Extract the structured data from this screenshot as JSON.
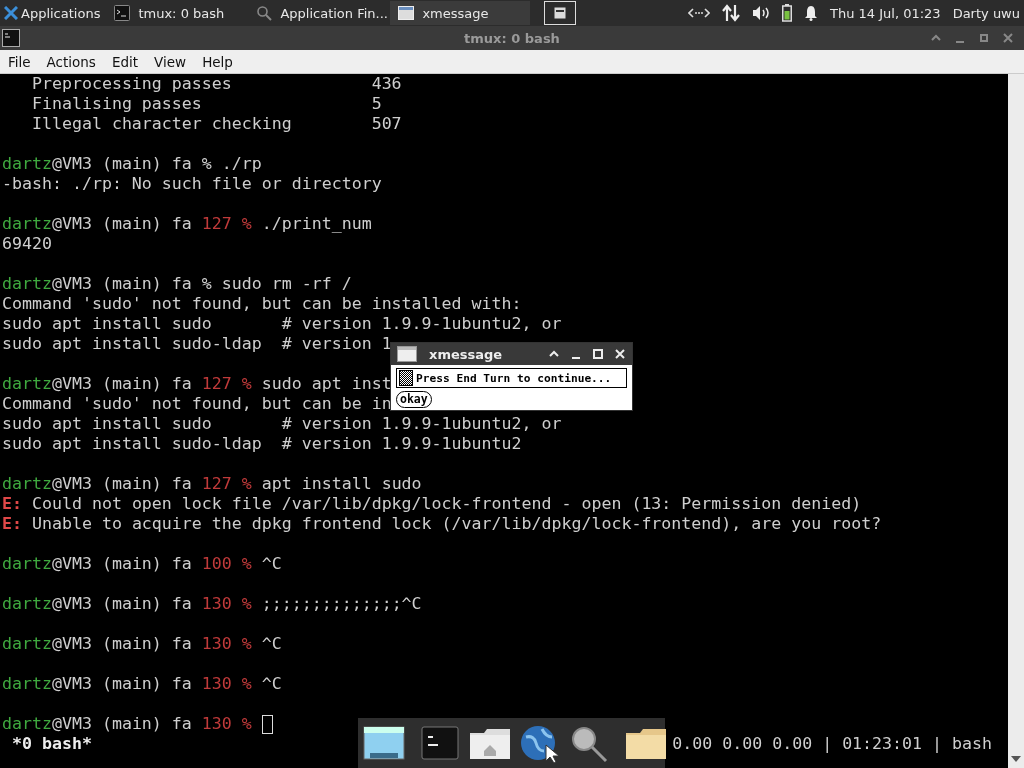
{
  "top_panel": {
    "applications_label": "Applications",
    "tasks": [
      {
        "label": "tmux: 0 bash",
        "selected": false
      },
      {
        "label": "Application Fin...",
        "selected": false
      },
      {
        "label": "xmessage",
        "selected": true
      }
    ],
    "clock": "Thu 14 Jul, 01:23",
    "user": "Darty uwu"
  },
  "window": {
    "title": "tmux: 0 bash"
  },
  "menu": [
    "File",
    "Actions",
    "Edit",
    "View",
    "Help"
  ],
  "terminal": {
    "lines": [
      {
        "kind": "text",
        "segments": [
          {
            "kind": "plain",
            "text": "   Preprocessing passes              436"
          }
        ]
      },
      {
        "kind": "text",
        "segments": [
          {
            "kind": "plain",
            "text": "   Finalising passes                 5"
          }
        ]
      },
      {
        "kind": "text",
        "segments": [
          {
            "kind": "plain",
            "text": "   Illegal character checking        507"
          }
        ]
      },
      {
        "kind": "blank"
      },
      {
        "kind": "text",
        "segments": [
          {
            "kind": "user",
            "text": "dartz"
          },
          {
            "kind": "plain",
            "text": "@VM3 (main) fa % ./rp"
          }
        ]
      },
      {
        "kind": "text",
        "segments": [
          {
            "kind": "plain",
            "text": "-bash: ./rp: No such file or directory"
          }
        ]
      },
      {
        "kind": "blank"
      },
      {
        "kind": "text",
        "segments": [
          {
            "kind": "user",
            "text": "dartz"
          },
          {
            "kind": "plain",
            "text": "@VM3 (main) fa "
          },
          {
            "kind": "code",
            "text": "127 %"
          },
          {
            "kind": "plain",
            "text": " ./print_num"
          }
        ]
      },
      {
        "kind": "text",
        "segments": [
          {
            "kind": "plain",
            "text": "69420"
          }
        ]
      },
      {
        "kind": "blank"
      },
      {
        "kind": "text",
        "segments": [
          {
            "kind": "user",
            "text": "dartz"
          },
          {
            "kind": "plain",
            "text": "@VM3 (main) fa % sudo rm -rf /"
          }
        ]
      },
      {
        "kind": "text",
        "segments": [
          {
            "kind": "plain",
            "text": "Command 'sudo' not found, but can be installed with:"
          }
        ]
      },
      {
        "kind": "text",
        "segments": [
          {
            "kind": "plain",
            "text": "sudo apt install sudo       # version 1.9.9-1ubuntu2, or"
          }
        ]
      },
      {
        "kind": "text",
        "segments": [
          {
            "kind": "plain",
            "text": "sudo apt install sudo-ldap  # version 1"
          }
        ]
      },
      {
        "kind": "blank"
      },
      {
        "kind": "text",
        "segments": [
          {
            "kind": "user",
            "text": "dartz"
          },
          {
            "kind": "plain",
            "text": "@VM3 (main) fa "
          },
          {
            "kind": "code",
            "text": "127 %"
          },
          {
            "kind": "plain",
            "text": " sudo apt inst"
          }
        ]
      },
      {
        "kind": "text",
        "segments": [
          {
            "kind": "plain",
            "text": "Command 'sudo' not found, but can be in"
          }
        ]
      },
      {
        "kind": "text",
        "segments": [
          {
            "kind": "plain",
            "text": "sudo apt install sudo       # version 1.9.9-1ubuntu2, or"
          }
        ]
      },
      {
        "kind": "text",
        "segments": [
          {
            "kind": "plain",
            "text": "sudo apt install sudo-ldap  # version 1.9.9-1ubuntu2"
          }
        ]
      },
      {
        "kind": "blank"
      },
      {
        "kind": "text",
        "segments": [
          {
            "kind": "user",
            "text": "dartz"
          },
          {
            "kind": "plain",
            "text": "@VM3 (main) fa "
          },
          {
            "kind": "code",
            "text": "127 %"
          },
          {
            "kind": "plain",
            "text": " apt install sudo"
          }
        ]
      },
      {
        "kind": "text",
        "segments": [
          {
            "kind": "error",
            "text": "E:"
          },
          {
            "kind": "plain",
            "text": " Could not open lock file /var/lib/dpkg/lock-frontend - open (13: Permission denied)"
          }
        ]
      },
      {
        "kind": "text",
        "segments": [
          {
            "kind": "error",
            "text": "E:"
          },
          {
            "kind": "plain",
            "text": " Unable to acquire the dpkg frontend lock (/var/lib/dpkg/lock-frontend), are you root?"
          }
        ]
      },
      {
        "kind": "blank"
      },
      {
        "kind": "text",
        "segments": [
          {
            "kind": "user",
            "text": "dartz"
          },
          {
            "kind": "plain",
            "text": "@VM3 (main) fa "
          },
          {
            "kind": "code",
            "text": "100 %"
          },
          {
            "kind": "plain",
            "text": " ^C"
          }
        ]
      },
      {
        "kind": "blank"
      },
      {
        "kind": "text",
        "segments": [
          {
            "kind": "user",
            "text": "dartz"
          },
          {
            "kind": "plain",
            "text": "@VM3 (main) fa "
          },
          {
            "kind": "code",
            "text": "130 %"
          },
          {
            "kind": "plain",
            "text": " ;;;;;;;;;;;;;;^C"
          }
        ]
      },
      {
        "kind": "blank"
      },
      {
        "kind": "text",
        "segments": [
          {
            "kind": "user",
            "text": "dartz"
          },
          {
            "kind": "plain",
            "text": "@VM3 (main) fa "
          },
          {
            "kind": "code",
            "text": "130 %"
          },
          {
            "kind": "plain",
            "text": " ^C"
          }
        ]
      },
      {
        "kind": "blank"
      },
      {
        "kind": "text",
        "segments": [
          {
            "kind": "user",
            "text": "dartz"
          },
          {
            "kind": "plain",
            "text": "@VM3 (main) fa "
          },
          {
            "kind": "code",
            "text": "130 %"
          },
          {
            "kind": "plain",
            "text": " ^C"
          }
        ]
      },
      {
        "kind": "blank"
      },
      {
        "kind": "text",
        "cursor": true,
        "segments": [
          {
            "kind": "user",
            "text": "dartz"
          },
          {
            "kind": "plain",
            "text": "@VM3 (main) fa "
          },
          {
            "kind": "code",
            "text": "130 %"
          }
        ]
      }
    ],
    "status_left": "*0 bash*",
    "status_right": "0.00 0.00 0.00 | 01:23:01 | bash"
  },
  "dialog": {
    "title": "xmessage",
    "message": "Press End Turn to continue...",
    "button": "okay"
  }
}
